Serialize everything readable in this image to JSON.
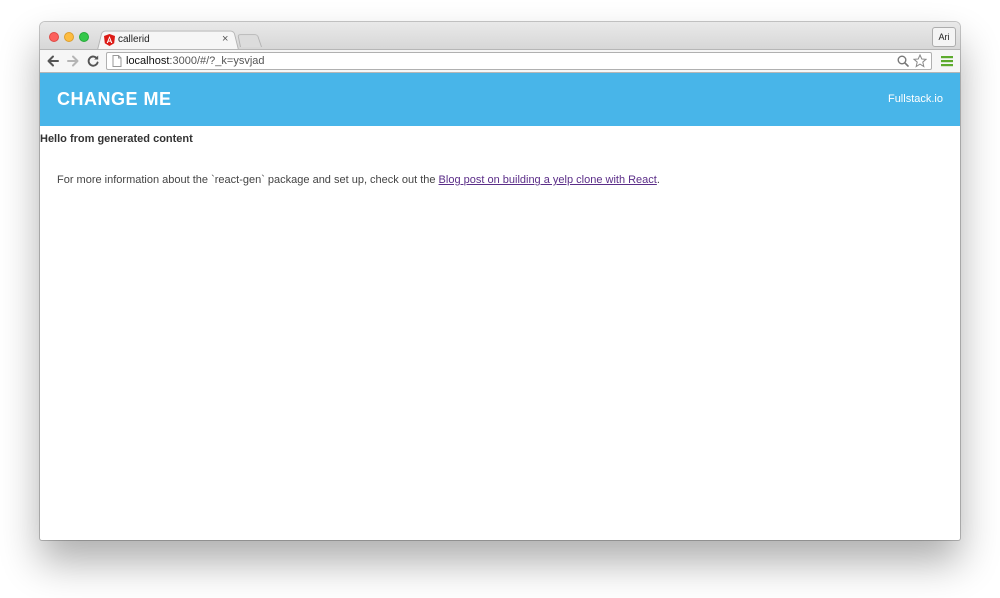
{
  "browser": {
    "tab": {
      "title": "callerid",
      "close_glyph": "×",
      "favicon": "angular-icon"
    },
    "profile_label": "Ari",
    "address_bar": {
      "host": "localhost",
      "path": ":3000/#/?_k=ysvjad"
    },
    "icons": [
      "back-icon",
      "forward-icon",
      "reload-icon",
      "page-icon",
      "zoom-icon",
      "star-icon",
      "menu-icon"
    ]
  },
  "app": {
    "header": {
      "brand": "CHANGE ME",
      "link": "Fullstack.io"
    },
    "heading": "Hello from generated content",
    "info": {
      "prefix": "For more information about the `react-gen` package and set up, check out the ",
      "link": "Blog post on building a yelp clone with React",
      "suffix": "."
    }
  },
  "colors": {
    "header_bg": "#48b5e9",
    "link": "#5b2d88"
  }
}
